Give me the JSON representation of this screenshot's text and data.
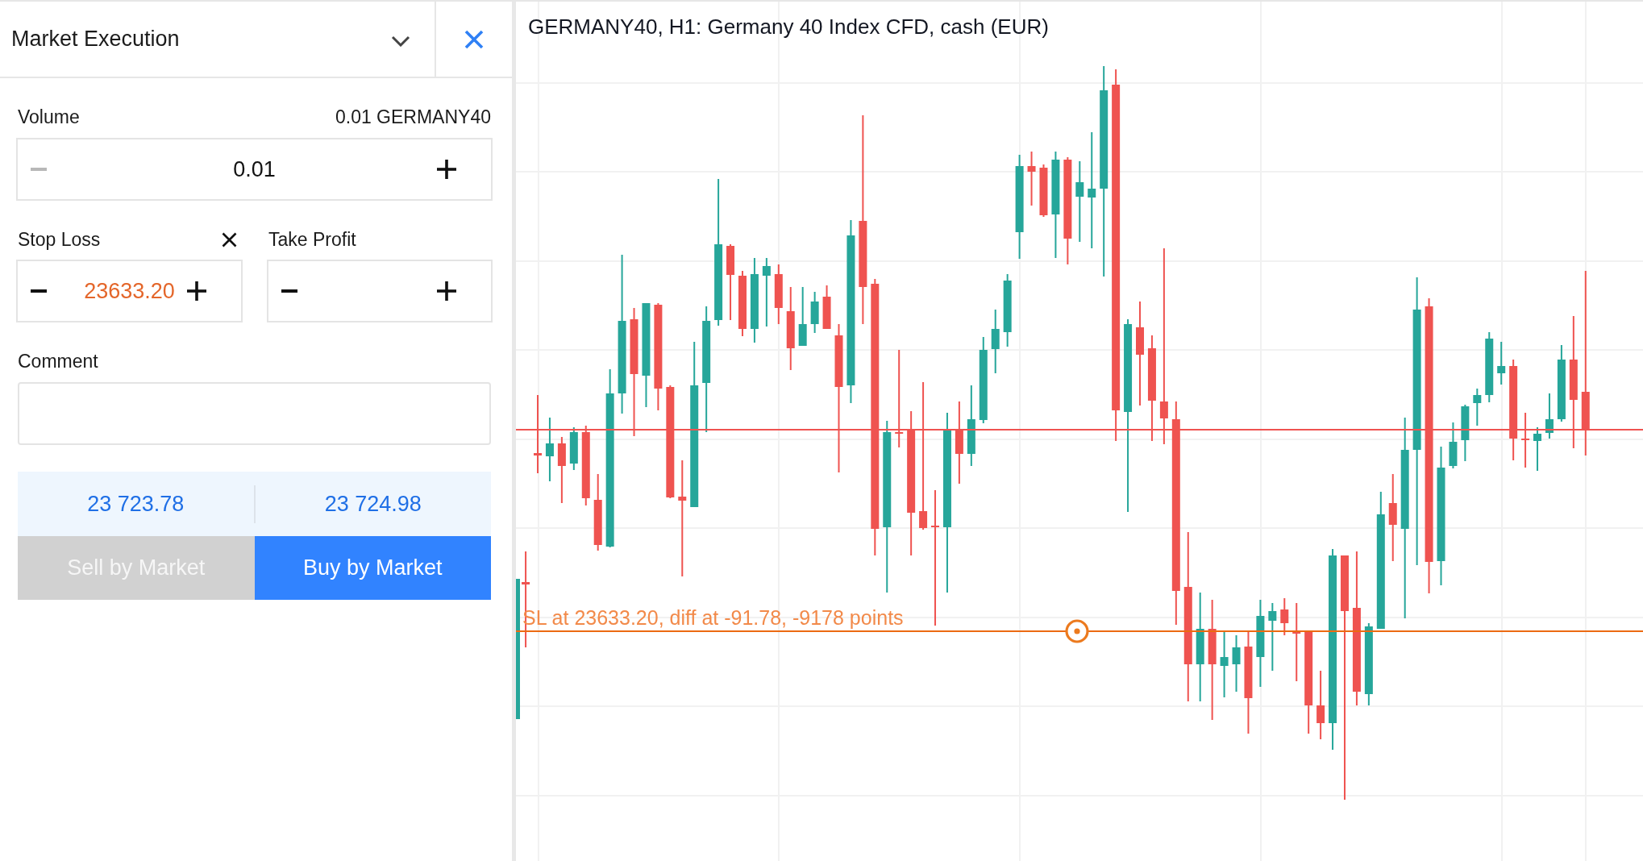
{
  "order_panel": {
    "order_type": {
      "label": "Market Execution"
    },
    "volume": {
      "label": "Volume",
      "summary": "0.01 GERMANY40",
      "value": "0.01",
      "decrement_disabled": true
    },
    "stop_loss": {
      "label": "Stop Loss",
      "value": "23633.20",
      "decrement_disabled": false
    },
    "take_profit": {
      "label": "Take Profit",
      "decrement_disabled": false
    },
    "comment": {
      "label": "Comment"
    },
    "actions": [
      {
        "kind": "sell",
        "price": "23 723.78",
        "label": "Sell by Market",
        "disabled": true
      },
      {
        "kind": "buy",
        "price": "23 724.98",
        "label": "Buy by Market",
        "disabled": false
      }
    ]
  },
  "chart": {
    "title": "GERMANY40, H1: Germany 40 Index CFD, cash (EUR)",
    "stop_loss": {
      "label": "SL at 23633.20, diff at -91.78, -9178 points"
    }
  }
}
